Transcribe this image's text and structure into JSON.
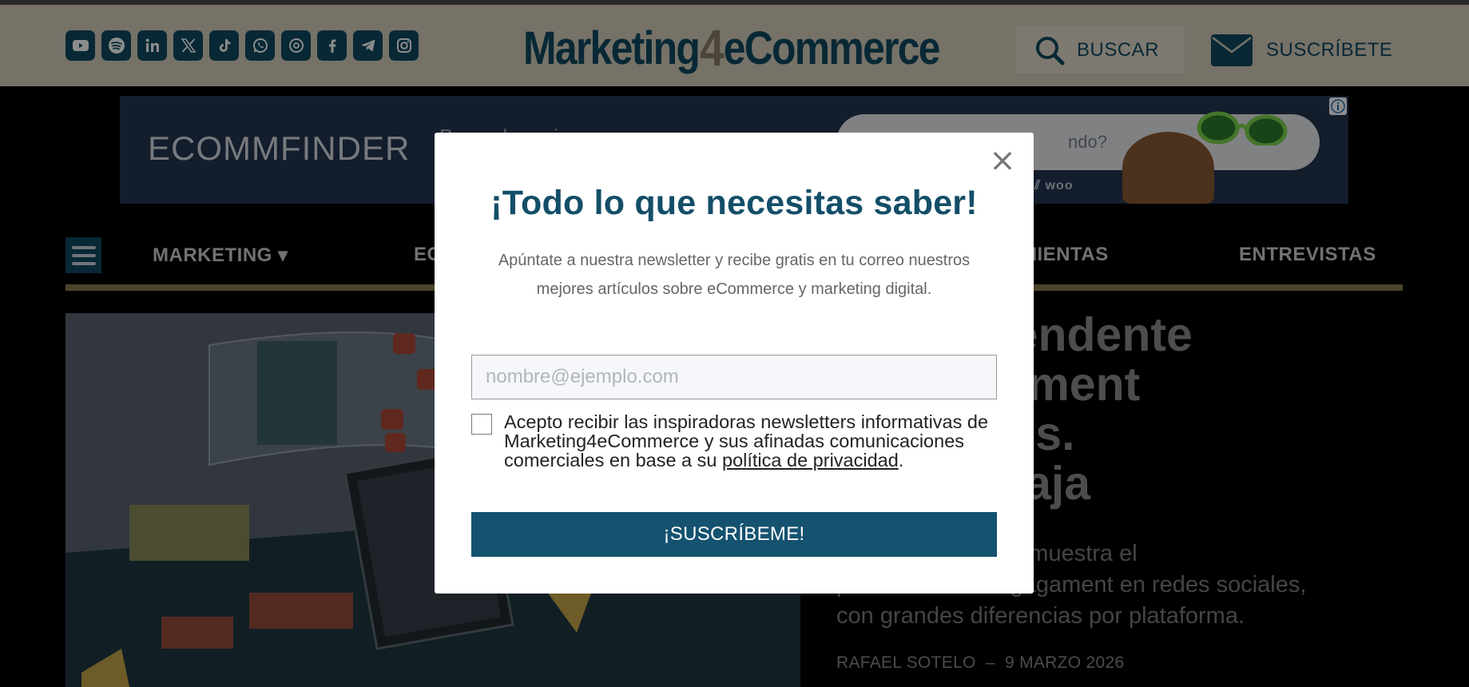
{
  "header": {
    "social_icons": [
      "youtube-icon",
      "spotify-icon",
      "linkedin-icon",
      "x-icon",
      "tiktok-icon",
      "whatsapp-icon",
      "threads-icon",
      "facebook-icon",
      "telegram-icon",
      "instagram-icon"
    ],
    "logo_left": "Marketing",
    "logo_four": "4",
    "logo_right": "eCommerce",
    "search_label": "BUSCAR",
    "subscribe_label": "SUSCRÍBETE"
  },
  "ad": {
    "brand": "ECOMMFINDER",
    "search_tail": "ndo?",
    "logos": "woo"
  },
  "nav": {
    "items": [
      {
        "label": "MARKETING ▾"
      },
      {
        "label": "EC"
      },
      {
        "label": "MIENTAS"
      },
      {
        "label": "ENTREVISTAS"
      }
    ]
  },
  "hero": {
    "title_lines": [
      "n, sorprendente",
      "l engagement",
      "s sociales.",
      "m, a la baja"
    ],
    "subtitle_lines": [
      "n escala de Buffer muestra el",
      "panorama del engagament en redes sociales,",
      "con grandes diferencias por plataforma."
    ],
    "author": "RAFAEL SOTELO",
    "separator": "–",
    "date": "9 MARZO 2026"
  },
  "modal": {
    "title": "¡Todo lo que necesitas saber!",
    "description": "Apúntate a nuestra newsletter y recibe gratis en tu correo nuestros mejores artículos sobre eCommerce y marketing digital.",
    "email_placeholder": "nombre@ejemplo.com",
    "email_value": "",
    "consent_text": "Acepto recibir las inspiradoras newsletters informativas de Marketing4eCommerce y sus afinadas comunicaciones comerciales en base a su ",
    "privacy_link": "política de privacidad",
    "consent_end": ".",
    "submit_label": "¡SUSCRÍBEME!",
    "close_glyph": "×"
  },
  "colors": {
    "brand_primary": "#0f4a61",
    "header_bg": "#d8cfbd",
    "nav_rule": "#8c7a4f",
    "button_bg": "#145270"
  }
}
